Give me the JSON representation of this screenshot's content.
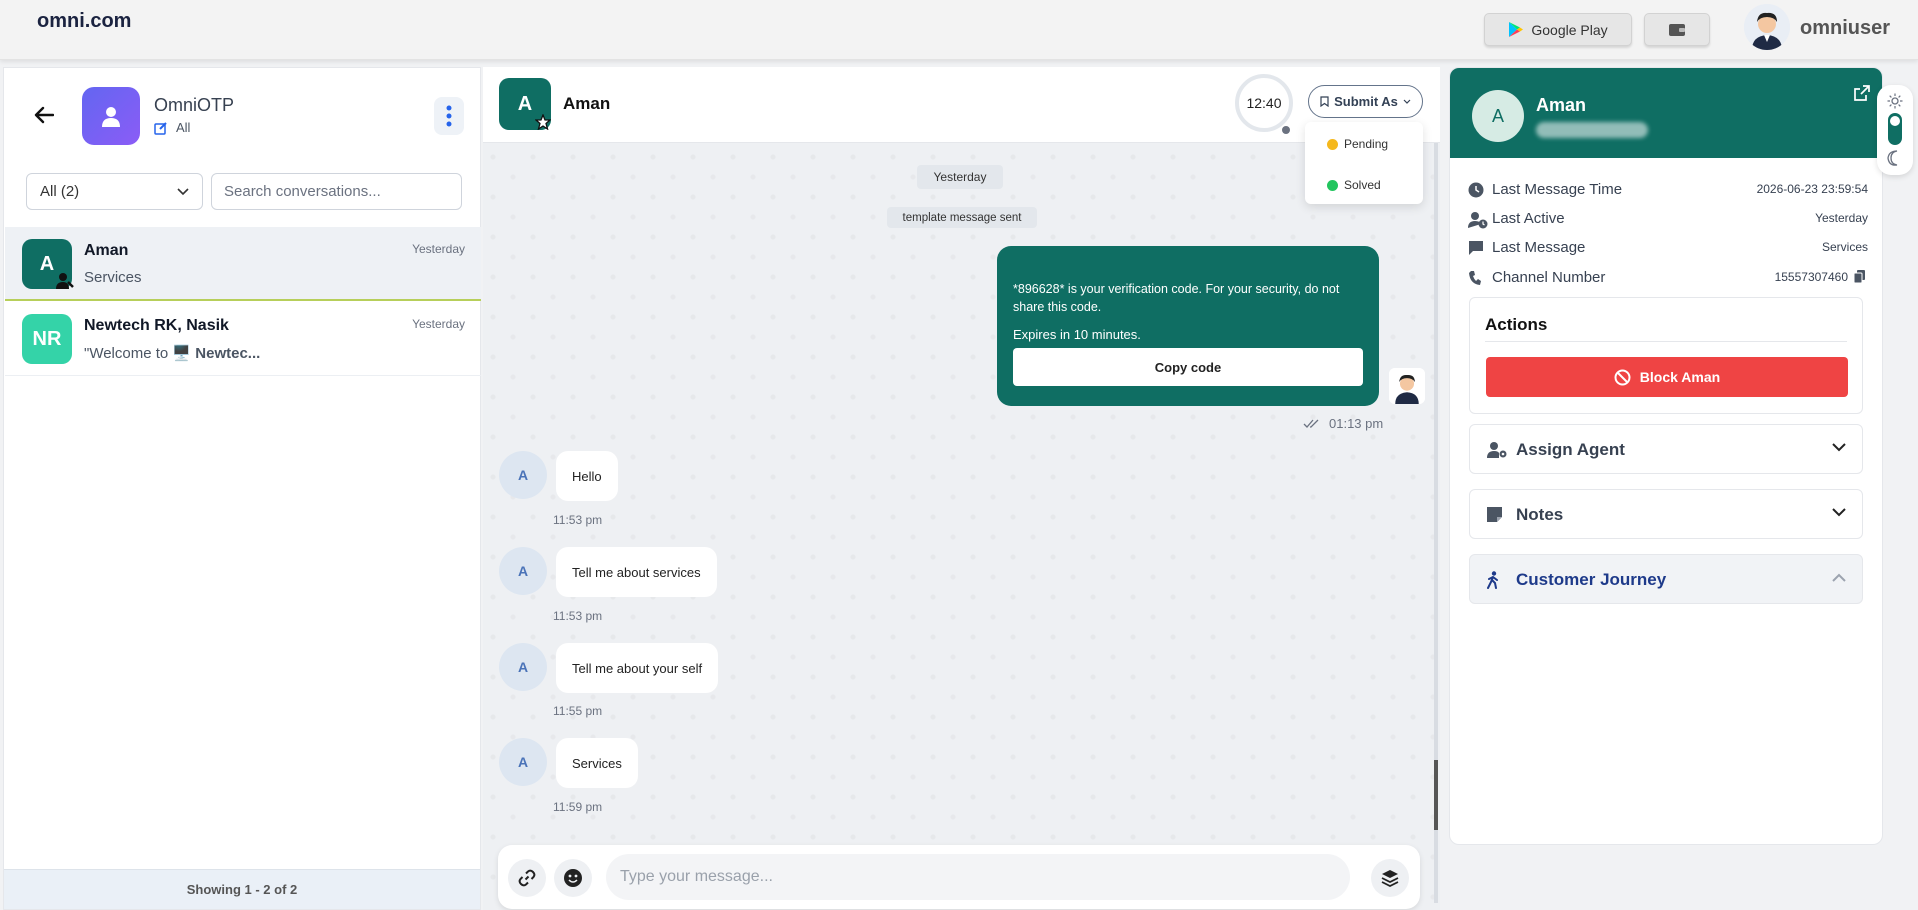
{
  "topbar": {
    "brand": "omni.com",
    "google_play_label": "Google Play",
    "username": "omniuser"
  },
  "sidebar": {
    "org_name": "OmniOTP",
    "org_filter": "All",
    "filter_value": "All (2)",
    "search_placeholder": "Search conversations...",
    "conversations": [
      {
        "initials": "A",
        "name": "Aman",
        "time": "Yesterday",
        "preview": "Services",
        "color": "#0f6e63",
        "active": true
      },
      {
        "initials": "NR",
        "name": "Newtech RK, Nasik",
        "time": "Yesterday",
        "preview_prefix": "\"Welcome to ",
        "preview_emoji": "🖥️",
        "preview_bold": "Newtec...",
        "color": "#34d3a8",
        "active": false
      }
    ],
    "showing": "Showing 1 - 2 of 2"
  },
  "chat": {
    "contact_initial": "A",
    "contact_name": "Aman",
    "timer": "12:40",
    "submit_label": "Submit As",
    "status_options": [
      {
        "label": "Pending",
        "color": "#f5b81d"
      },
      {
        "label": "Solved",
        "color": "#22c55e"
      }
    ],
    "day_label": "Yesterday",
    "system_note": "template message sent",
    "template": {
      "text": "*896628* is your verification code. For your security, do not share this code.",
      "expiry": "Expires in 10 minutes.",
      "button": "Copy code",
      "time": "01:13 pm"
    },
    "messages": [
      {
        "avatar": "A",
        "text": "Hello",
        "time": "11:53 pm"
      },
      {
        "avatar": "A",
        "text": "Tell me about services",
        "time": "11:53 pm"
      },
      {
        "avatar": "A",
        "text": "Tell me about your self",
        "time": "11:55 pm"
      },
      {
        "avatar": "A",
        "text": "Services",
        "time": "11:59 pm"
      }
    ],
    "input_placeholder": "Type your message..."
  },
  "details": {
    "initial": "A",
    "name": "Aman",
    "info": [
      {
        "label": "Last Message Time",
        "value": "2026-06-23 23:59:54",
        "icon": "clock-icon"
      },
      {
        "label": "Last Active",
        "value": "Yesterday",
        "icon": "user-clock-icon"
      },
      {
        "label": "Last Message",
        "value": "Services",
        "icon": "message-icon"
      },
      {
        "label": "Channel Number",
        "value": "15557307460",
        "icon": "phone-icon"
      }
    ],
    "actions_title": "Actions",
    "block_label": "Block Aman",
    "assign_agent": "Assign Agent",
    "notes": "Notes",
    "customer_journey": "Customer Journey"
  },
  "colors": {
    "brand_teal": "#0f6e63",
    "danger": "#ef4444",
    "accent_purple": "#6366f1"
  }
}
